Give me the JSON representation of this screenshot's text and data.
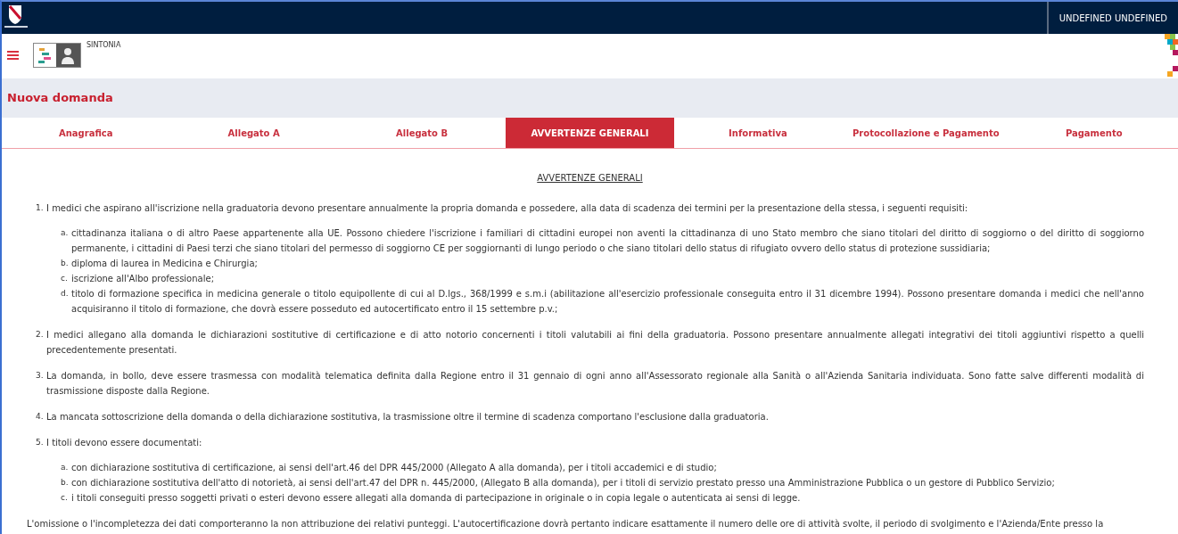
{
  "top_bar": {
    "user": "UNDEFINED UNDEFINED"
  },
  "header": {
    "app_name": "SINTONIA"
  },
  "page_title": "Nuova domanda",
  "tabs": [
    {
      "label": "Anagrafica",
      "selected": false
    },
    {
      "label": "Allegato A",
      "selected": false
    },
    {
      "label": "Allegato B",
      "selected": false
    },
    {
      "label": "AVVERTENZE GENERALI",
      "selected": true
    },
    {
      "label": "Informativa",
      "selected": false
    },
    {
      "label": "Protocollazione e Pagamento",
      "selected": false
    },
    {
      "label": "Pagamento",
      "selected": false
    }
  ],
  "content": {
    "heading": "AVVERTENZE GENERALI",
    "items": [
      {
        "marker": "1.",
        "text": "I medici che aspirano all'iscrizione nella graduatoria devono presentare annualmente la propria domanda e possedere, alla data di scadenza dei termini per la presentazione della stessa, i seguenti requisiti:",
        "children": [
          {
            "marker": "a.",
            "text": "cittadinanza italiana o di altro Paese appartenente alla UE. Possono chiedere l'iscrizione i familiari di cittadini europei non aventi la cittadinanza di uno Stato membro che siano titolari del diritto di soggiorno o del diritto di soggiorno permanente, i cittadini di Paesi terzi che siano titolari del permesso di soggiorno CE per soggiornanti di lungo periodo o che siano titolari dello status di rifugiato ovvero dello status di protezione sussidiaria;"
          },
          {
            "marker": "b.",
            "text": "diploma di laurea in Medicina e Chirurgia;"
          },
          {
            "marker": "c.",
            "text": "iscrizione all'Albo professionale;"
          },
          {
            "marker": "d.",
            "text": "titolo di formazione specifica in medicina generale o titolo equipollente di cui al D.lgs., 368/1999 e s.m.i (abilitazione all'esercizio professionale conseguita entro il 31 dicembre 1994). Possono presentare domanda i medici che nell'anno acquisiranno il titolo di formazione, che dovrà essere posseduto ed autocertificato entro il 15 settembre p.v.;"
          }
        ]
      },
      {
        "marker": "2.",
        "text": "I medici allegano alla domanda le dichiarazioni sostitutive di certificazione e di atto notorio concernenti i titoli valutabili ai fini della graduatoria. Possono presentare annualmente allegati integrativi dei titoli aggiuntivi rispetto a quelli precedentemente presentati."
      },
      {
        "marker": "3.",
        "text": "La domanda, in bollo, deve essere trasmessa con modalità telematica definita dalla Regione entro il 31 gennaio di ogni anno all'Assessorato regionale alla Sanità o all'Azienda Sanitaria individuata. Sono fatte salve differenti modalità di trasmissione disposte dalla Regione."
      },
      {
        "marker": "4.",
        "text": "La mancata sottoscrizione della domanda o della dichiarazione sostitutiva, la trasmissione oltre il termine di scadenza comportano l'esclusione dalla graduatoria."
      },
      {
        "marker": "5.",
        "text": "I titoli devono essere documentati:",
        "children": [
          {
            "marker": "a.",
            "text": "con dichiarazione sostitutiva di certificazione, ai sensi dell'art.46 del DPR 445/2000 (Allegato A alla domanda), per i titoli accademici e di studio;"
          },
          {
            "marker": "b.",
            "text": "con dichiarazione sostitutiva dell'atto di notorietà, ai sensi dell'art.47 del DPR n. 445/2000, (Allegato B alla domanda), per i titoli di servizio prestato presso una Amministrazione Pubblica o un gestore di Pubblico Servizio;"
          },
          {
            "marker": "c.",
            "text": "i titoli conseguiti presso soggetti privati o esteri devono essere allegati alla domanda di partecipazione in originale o in copia legale o autenticata ai sensi di legge."
          }
        ]
      }
    ],
    "note": "L'omissione o l'incompletezza dei dati comporteranno la non attribuzione dei relativi punteggi. L'autocertificazione dovrà pertanto indicare esattamente il numero delle ore di attività svolte, il periodo di svolgimento e l'Azienda/Ente presso la"
  }
}
